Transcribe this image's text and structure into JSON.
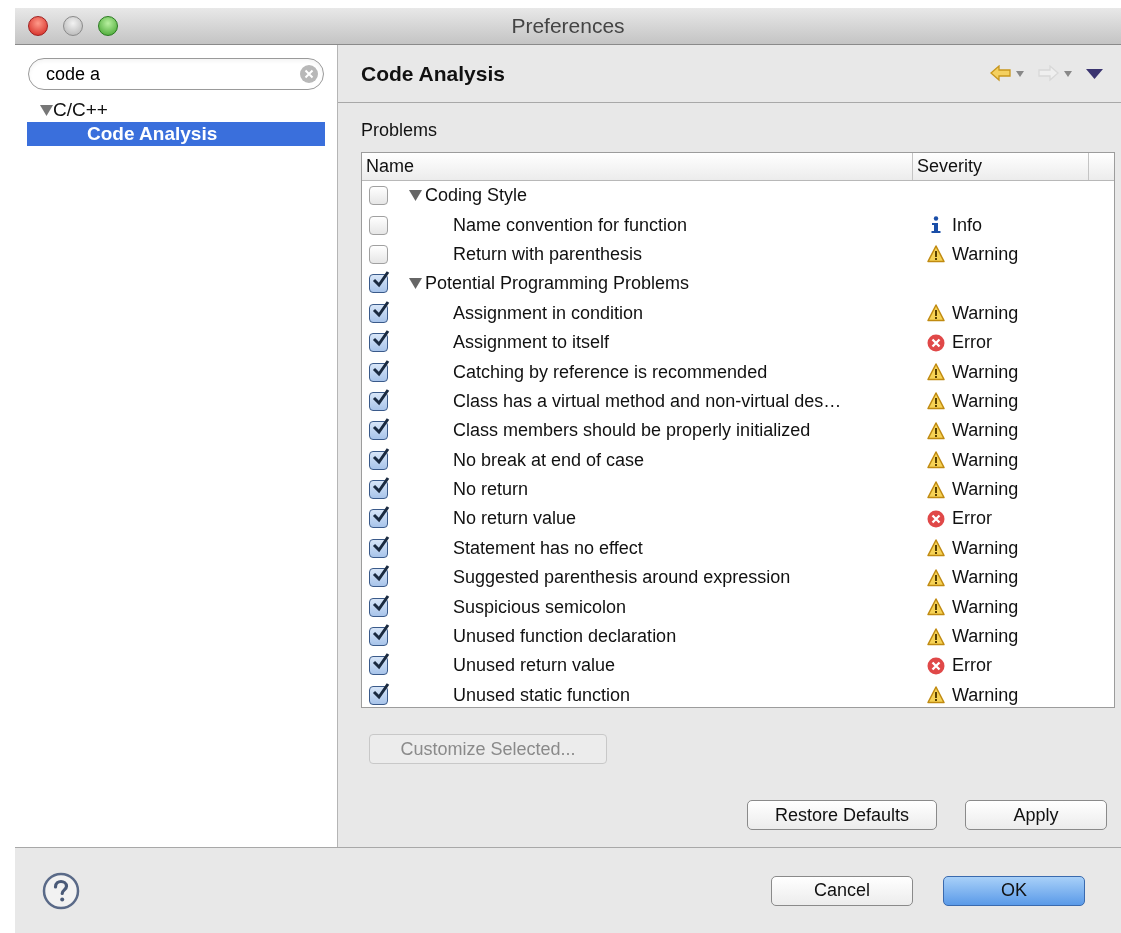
{
  "window": {
    "title": "Preferences"
  },
  "search": {
    "value": "code a"
  },
  "tree": [
    {
      "label": "C/C++",
      "expanded": true,
      "selected": false,
      "children": [
        {
          "label": "Code Analysis",
          "selected": true
        }
      ]
    }
  ],
  "page": {
    "title": "Code Analysis",
    "back_enabled": true,
    "forward_enabled": false
  },
  "problems": {
    "label": "Problems",
    "columns": [
      "Name",
      "Severity"
    ],
    "groups": [
      {
        "label": "Coding Style",
        "checked": false,
        "expanded": true,
        "children": [
          {
            "label": "Name convention for function",
            "checked": false,
            "severity": {
              "kind": "info",
              "text": "Info"
            }
          },
          {
            "label": "Return with parenthesis",
            "checked": false,
            "severity": {
              "kind": "warning",
              "text": "Warning"
            }
          }
        ]
      },
      {
        "label": "Potential Programming Problems",
        "checked": true,
        "expanded": true,
        "children": [
          {
            "label": "Assignment in condition",
            "checked": true,
            "severity": {
              "kind": "warning",
              "text": "Warning"
            }
          },
          {
            "label": "Assignment to itself",
            "checked": true,
            "severity": {
              "kind": "error",
              "text": "Error"
            }
          },
          {
            "label": "Catching by reference is recommended",
            "checked": true,
            "severity": {
              "kind": "warning",
              "text": "Warning"
            }
          },
          {
            "label": "Class has a virtual method and non-virtual des…",
            "checked": true,
            "severity": {
              "kind": "warning",
              "text": "Warning"
            }
          },
          {
            "label": "Class members should be properly initialized",
            "checked": true,
            "severity": {
              "kind": "warning",
              "text": "Warning"
            }
          },
          {
            "label": "No break at end of case",
            "checked": true,
            "severity": {
              "kind": "warning",
              "text": "Warning"
            }
          },
          {
            "label": "No return",
            "checked": true,
            "severity": {
              "kind": "warning",
              "text": "Warning"
            }
          },
          {
            "label": "No return value",
            "checked": true,
            "severity": {
              "kind": "error",
              "text": "Error"
            }
          },
          {
            "label": "Statement has no effect",
            "checked": true,
            "severity": {
              "kind": "warning",
              "text": "Warning"
            }
          },
          {
            "label": "Suggested parenthesis around expression",
            "checked": true,
            "severity": {
              "kind": "warning",
              "text": "Warning"
            }
          },
          {
            "label": "Suspicious semicolon",
            "checked": true,
            "severity": {
              "kind": "warning",
              "text": "Warning"
            }
          },
          {
            "label": "Unused function declaration",
            "checked": true,
            "severity": {
              "kind": "warning",
              "text": "Warning"
            }
          },
          {
            "label": "Unused return value",
            "checked": true,
            "severity": {
              "kind": "error",
              "text": "Error"
            }
          },
          {
            "label": "Unused static function",
            "checked": true,
            "severity": {
              "kind": "warning",
              "text": "Warning"
            }
          }
        ]
      }
    ]
  },
  "customize_button": {
    "label": "Customize Selected...",
    "disabled": true
  },
  "page_buttons": [
    {
      "label": "Restore Defaults",
      "default": false
    },
    {
      "label": "Apply",
      "default": false
    }
  ],
  "dialog_buttons": [
    {
      "label": "Cancel",
      "default": false
    },
    {
      "label": "OK",
      "default": true
    }
  ]
}
